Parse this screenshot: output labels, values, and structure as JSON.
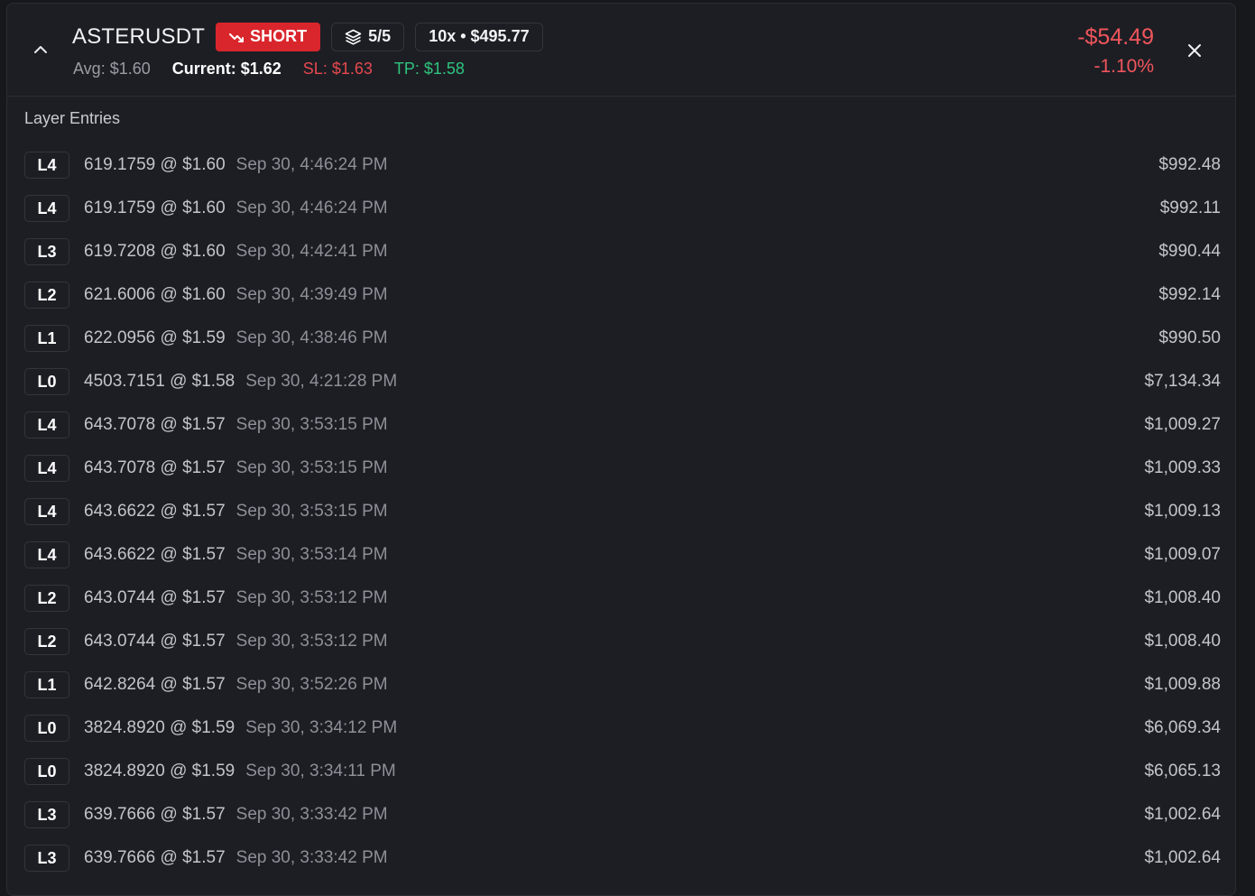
{
  "colors": {
    "background": "#1d1e24",
    "short_badge": "#d9262c",
    "loss": "#f0565c",
    "stop_loss": "#e5484d",
    "take_profit": "#2fc47d"
  },
  "position": {
    "symbol": "ASTERUSDT",
    "side": "SHORT",
    "side_icon": "trend-down-icon",
    "layers_icon": "layers-icon",
    "layers": "5/5",
    "leverage_margin": "10x • $495.77",
    "avg": "Avg: $1.60",
    "current": "Current: $1.62",
    "sl": "SL: $1.63",
    "tp": "TP: $1.58",
    "pnl_amount": "-$54.49",
    "pnl_percent": "-1.10%",
    "collapse_icon": "chevron-up-icon",
    "close_icon": "close-icon"
  },
  "section": {
    "title": "Layer Entries"
  },
  "entries": [
    {
      "layer": "L4",
      "qty_price": "619.1759 @ $1.60",
      "time": "Sep 30, 4:46:24 PM",
      "value": "$992.48"
    },
    {
      "layer": "L4",
      "qty_price": "619.1759 @ $1.60",
      "time": "Sep 30, 4:46:24 PM",
      "value": "$992.11"
    },
    {
      "layer": "L3",
      "qty_price": "619.7208 @ $1.60",
      "time": "Sep 30, 4:42:41 PM",
      "value": "$990.44"
    },
    {
      "layer": "L2",
      "qty_price": "621.6006 @ $1.60",
      "time": "Sep 30, 4:39:49 PM",
      "value": "$992.14"
    },
    {
      "layer": "L1",
      "qty_price": "622.0956 @ $1.59",
      "time": "Sep 30, 4:38:46 PM",
      "value": "$990.50"
    },
    {
      "layer": "L0",
      "qty_price": "4503.7151 @ $1.58",
      "time": "Sep 30, 4:21:28 PM",
      "value": "$7,134.34"
    },
    {
      "layer": "L4",
      "qty_price": "643.7078 @ $1.57",
      "time": "Sep 30, 3:53:15 PM",
      "value": "$1,009.27"
    },
    {
      "layer": "L4",
      "qty_price": "643.7078 @ $1.57",
      "time": "Sep 30, 3:53:15 PM",
      "value": "$1,009.33"
    },
    {
      "layer": "L4",
      "qty_price": "643.6622 @ $1.57",
      "time": "Sep 30, 3:53:15 PM",
      "value": "$1,009.13"
    },
    {
      "layer": "L4",
      "qty_price": "643.6622 @ $1.57",
      "time": "Sep 30, 3:53:14 PM",
      "value": "$1,009.07"
    },
    {
      "layer": "L2",
      "qty_price": "643.0744 @ $1.57",
      "time": "Sep 30, 3:53:12 PM",
      "value": "$1,008.40"
    },
    {
      "layer": "L2",
      "qty_price": "643.0744 @ $1.57",
      "time": "Sep 30, 3:53:12 PM",
      "value": "$1,008.40"
    },
    {
      "layer": "L1",
      "qty_price": "642.8264 @ $1.57",
      "time": "Sep 30, 3:52:26 PM",
      "value": "$1,009.88"
    },
    {
      "layer": "L0",
      "qty_price": "3824.8920 @ $1.59",
      "time": "Sep 30, 3:34:12 PM",
      "value": "$6,069.34"
    },
    {
      "layer": "L0",
      "qty_price": "3824.8920 @ $1.59",
      "time": "Sep 30, 3:34:11 PM",
      "value": "$6,065.13"
    },
    {
      "layer": "L3",
      "qty_price": "639.7666 @ $1.57",
      "time": "Sep 30, 3:33:42 PM",
      "value": "$1,002.64"
    },
    {
      "layer": "L3",
      "qty_price": "639.7666 @ $1.57",
      "time": "Sep 30, 3:33:42 PM",
      "value": "$1,002.64"
    }
  ]
}
